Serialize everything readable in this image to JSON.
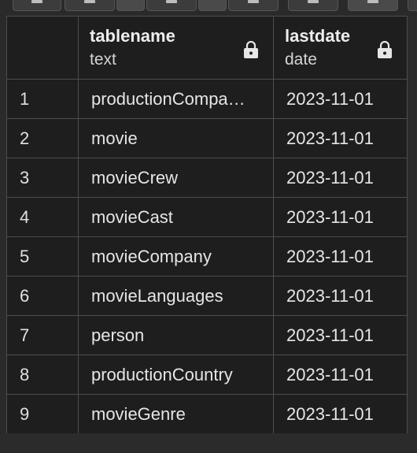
{
  "columns": [
    {
      "name": "tablename",
      "type": "text"
    },
    {
      "name": "lastdate",
      "type": "date"
    }
  ],
  "rows": [
    {
      "num": "1",
      "tablename": "productionCompa…",
      "lastdate": "2023-11-01"
    },
    {
      "num": "2",
      "tablename": "movie",
      "lastdate": "2023-11-01"
    },
    {
      "num": "3",
      "tablename": "movieCrew",
      "lastdate": "2023-11-01"
    },
    {
      "num": "4",
      "tablename": "movieCast",
      "lastdate": "2023-11-01"
    },
    {
      "num": "5",
      "tablename": "movieCompany",
      "lastdate": "2023-11-01"
    },
    {
      "num": "6",
      "tablename": "movieLanguages",
      "lastdate": "2023-11-01"
    },
    {
      "num": "7",
      "tablename": "person",
      "lastdate": "2023-11-01"
    },
    {
      "num": "8",
      "tablename": "productionCountry",
      "lastdate": "2023-11-01"
    },
    {
      "num": "9",
      "tablename": "movieGenre",
      "lastdate": "2023-11-01"
    }
  ],
  "icons": {
    "header_lock": "lock-icon"
  },
  "colors": {
    "background": "#1e1e1e",
    "border": "#4d4d4d",
    "text": "#e6e6e6"
  }
}
